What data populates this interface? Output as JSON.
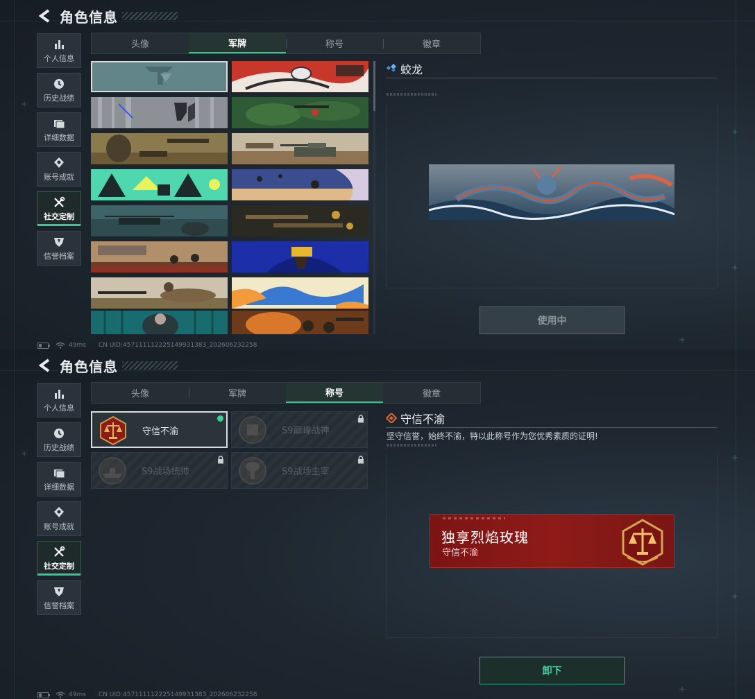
{
  "header": {
    "title": "角色信息"
  },
  "sidebar": {
    "items": [
      {
        "label": "个人信息",
        "icon": "bar-chart-icon"
      },
      {
        "label": "历史战绩",
        "icon": "clock-icon"
      },
      {
        "label": "详细数据",
        "icon": "folder-icon"
      },
      {
        "label": "账号成就",
        "icon": "achievement-icon"
      },
      {
        "label": "社交定制",
        "icon": "wrench-screwdriver-icon",
        "active": true
      },
      {
        "label": "信誉档案",
        "icon": "shield-badge-icon"
      }
    ]
  },
  "tabs": [
    "头像",
    "军牌",
    "称号",
    "徽章"
  ],
  "panel1": {
    "active_tab": "军牌",
    "dogtag_cards": [
      {
        "theme": "teal-logo",
        "selected": true
      },
      {
        "theme": "red-white-abstract"
      },
      {
        "theme": "silver-logo"
      },
      {
        "theme": "green-jungle"
      },
      {
        "theme": "desert-soldiers"
      },
      {
        "theme": "desert-tank"
      },
      {
        "theme": "green-cartoon"
      },
      {
        "theme": "parachute-sky"
      },
      {
        "theme": "helicopter-teal"
      },
      {
        "theme": "weapons-dark"
      },
      {
        "theme": "battlefield-sunset"
      },
      {
        "theme": "blue-yellow-abstract"
      },
      {
        "theme": "sniper-prone"
      },
      {
        "theme": "blue-orange-paint"
      },
      {
        "theme": "teal-fighter"
      },
      {
        "theme": "explosion-soldiers"
      }
    ],
    "detail": {
      "name": "蛟龙",
      "preview": "dragon-waves-dogtag",
      "button_label": "使用中"
    }
  },
  "panel2": {
    "active_tab": "称号",
    "title_cards": [
      {
        "label": "守信不渝",
        "selected": true,
        "equipped": true,
        "locked": false
      },
      {
        "label": "S9巅峰战神",
        "selected": false,
        "locked": true
      },
      {
        "label": "S9战场统帅",
        "selected": false,
        "locked": true
      },
      {
        "label": "S9战场主宰",
        "selected": false,
        "locked": true
      }
    ],
    "detail": {
      "name": "守信不渝",
      "description": "坚守信誉，始终不渝，特以此称号作为您优秀素质的证明!",
      "nameplate_main": "独享烈焰玫瑰",
      "nameplate_sub": "守信不渝",
      "button_label": "卸下"
    }
  },
  "footer": {
    "ping": "49ms",
    "uid": "CN UID:457111112225149931383_202606232258"
  },
  "colors": {
    "accent": "#35c99a",
    "background": "#1b232b",
    "nameplate_red": "#8e1b18",
    "equipped_dot": "#39d28f"
  }
}
